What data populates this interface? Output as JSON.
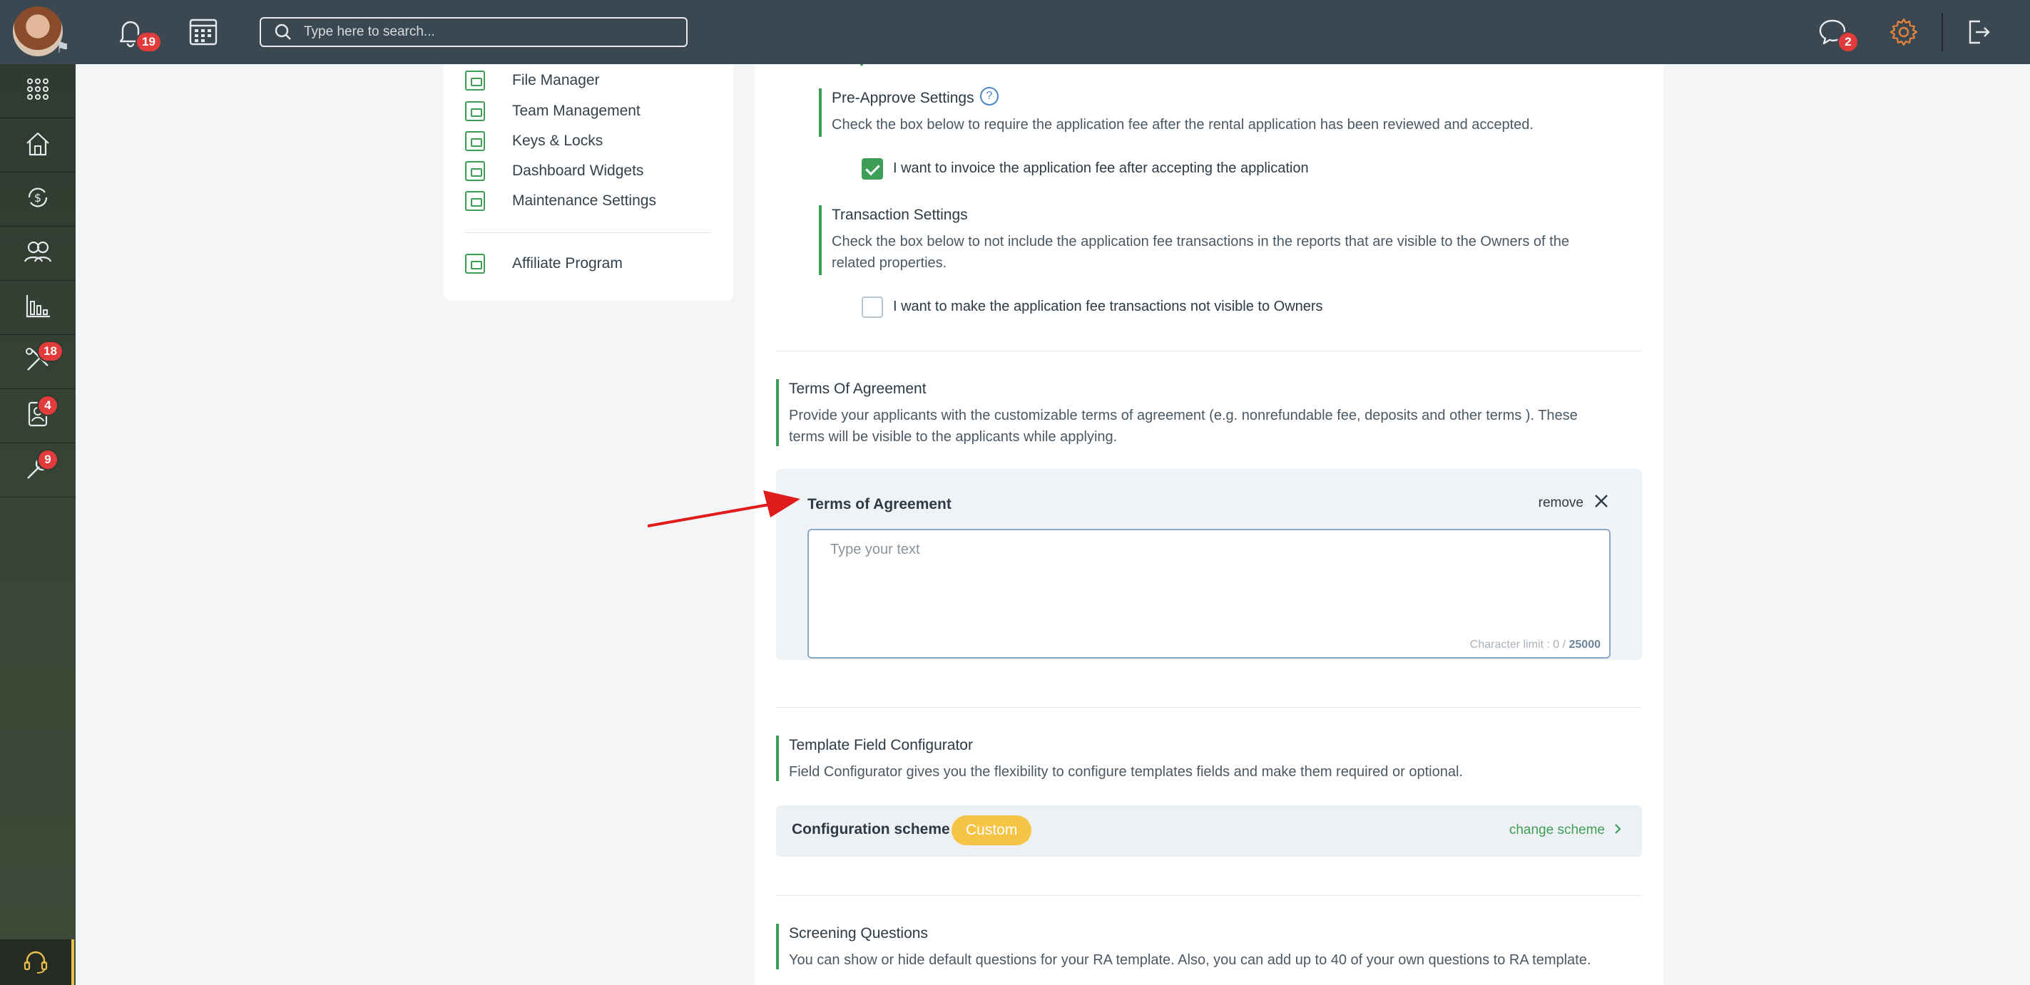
{
  "topbar": {
    "notifications_count": "19",
    "search_placeholder": "Type here to search...",
    "messages_count": "2"
  },
  "sidebar": {
    "badges": {
      "maintenance": "18",
      "applicants": "4",
      "tools": "9"
    }
  },
  "settings_nav": {
    "items": [
      "File Manager",
      "Team Management",
      "Keys & Locks",
      "Dashboard Widgets",
      "Maintenance Settings"
    ],
    "affiliate": "Affiliate Program"
  },
  "pre_approve": {
    "title": "Pre-Approve Settings",
    "help": "?",
    "description": "Check the box below to require the application fee after the rental application has been reviewed and accepted.",
    "checkbox_label": "I want to invoice the application fee after accepting the application",
    "checked": true
  },
  "transaction": {
    "title": "Transaction Settings",
    "description_line1": "Check the box below to not include the application fee transactions in the reports that are visible to the Owners of the",
    "description_line2": "related properties.",
    "checkbox_label": "I want to make the application fee transactions not visible to Owners",
    "checked": false
  },
  "terms_section": {
    "title": "Terms Of Agreement",
    "description_line1": "Provide your applicants with the customizable terms of agreement (e.g. nonrefundable fee, deposits and other terms ). These",
    "description_line2": "terms will be visible to the applicants while applying.",
    "box_title": "Terms of Agreement",
    "remove_label": "remove",
    "placeholder": "Type your text",
    "value": "",
    "char_limit_prefix": "Character limit : 0 / ",
    "char_limit_max": "25000"
  },
  "template_config": {
    "title": "Template Field Configurator",
    "description": "Field Configurator gives you the flexibility to configure templates fields and make them required or optional.",
    "scheme_label": "Configuration scheme",
    "scheme_value": "Custom",
    "change_label": "change scheme"
  },
  "screening": {
    "title": "Screening Questions",
    "description": "You can show or hide default questions for your RA template. Also, you can add up to 40 of your own questions to RA template."
  },
  "colors": {
    "topbar": "#3b4852",
    "accent_green": "#3e9d57",
    "badge_red": "#e23b3b",
    "pill_yellow": "#f6c445",
    "settings_orange": "#e8833a",
    "arrow_red": "#e01b1b"
  }
}
